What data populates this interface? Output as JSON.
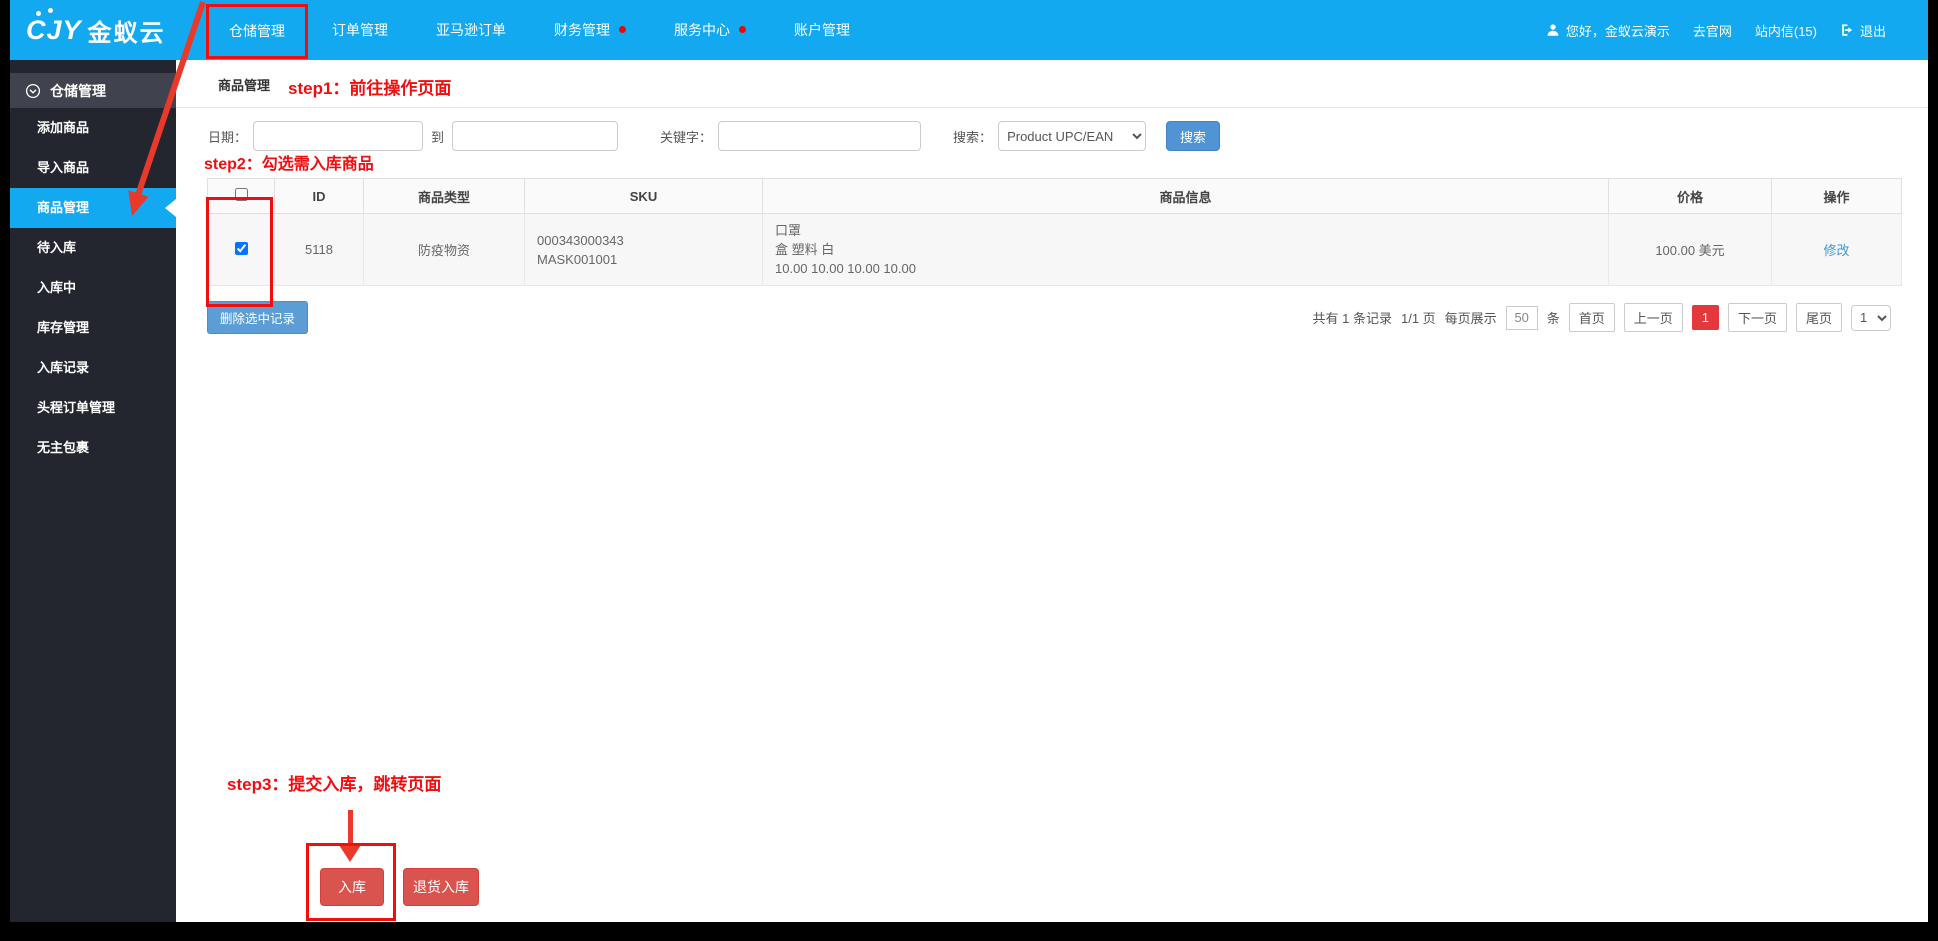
{
  "header": {
    "logo_mark": "CJY",
    "logo_text": "金蚁云",
    "nav": [
      {
        "label": "仓储管理"
      },
      {
        "label": "订单管理"
      },
      {
        "label": "亚马逊订单"
      },
      {
        "label": "财务管理"
      },
      {
        "label": "服务中心"
      },
      {
        "label": "账户管理"
      }
    ],
    "user": {
      "greeting": "您好，金蚁云演示",
      "official_site": "去官网",
      "messages": "站内信(15)",
      "logout": "退出"
    }
  },
  "sidebar": {
    "section": "仓储管理",
    "items": [
      {
        "label": "添加商品"
      },
      {
        "label": "导入商品"
      },
      {
        "label": "商品管理"
      },
      {
        "label": "待入库"
      },
      {
        "label": "入库中"
      },
      {
        "label": "库存管理"
      },
      {
        "label": "入库记录"
      },
      {
        "label": "头程订单管理"
      },
      {
        "label": "无主包裹"
      }
    ]
  },
  "main": {
    "breadcrumb": "商品管理",
    "annotations": {
      "step1": "step1：前往操作页面",
      "step2": "step2：勾选需入库商品",
      "step3": "step3：提交入库，跳转页面"
    },
    "filters": {
      "date_label": "日期：",
      "to_label": "到",
      "keyword_label": "关键字：",
      "search_label": "搜索：",
      "search_type_value": "Product UPC/EAN",
      "search_button": "搜索"
    },
    "table": {
      "headers": [
        "ID",
        "商品类型",
        "SKU",
        "商品信息",
        "价格",
        "操作"
      ],
      "rows": [
        {
          "checked": true,
          "id": "5118",
          "type": "防疫物资",
          "sku_line1": "000343000343",
          "sku_line2": "MASK001001",
          "info_line1": "口罩",
          "info_line2": "盒 塑料 白",
          "info_line3": "10.00 10.00 10.00 10.00",
          "price": "100.00 美元",
          "action": "修改"
        }
      ]
    },
    "delete_button": "删除选中记录",
    "pagination": {
      "total_text": "共有 1 条记录",
      "page_text": "1/1 页",
      "per_page_label": "每页展示",
      "per_page_value": "50",
      "per_page_unit": "条",
      "first": "首页",
      "prev": "上一页",
      "current": "1",
      "next": "下一页",
      "last": "尾页",
      "page_select_value": "1"
    },
    "bottom_buttons": {
      "inbound": "入库",
      "return_inbound": "退货入库"
    }
  },
  "colors": {
    "header_blue": "#12a9f0",
    "sidebar_dark": "#24262f",
    "annotation_red": "#f10e0e",
    "pager_current_red": "#e4393c",
    "danger_button_red": "#d9534f",
    "link_blue": "#3c9ad9"
  }
}
